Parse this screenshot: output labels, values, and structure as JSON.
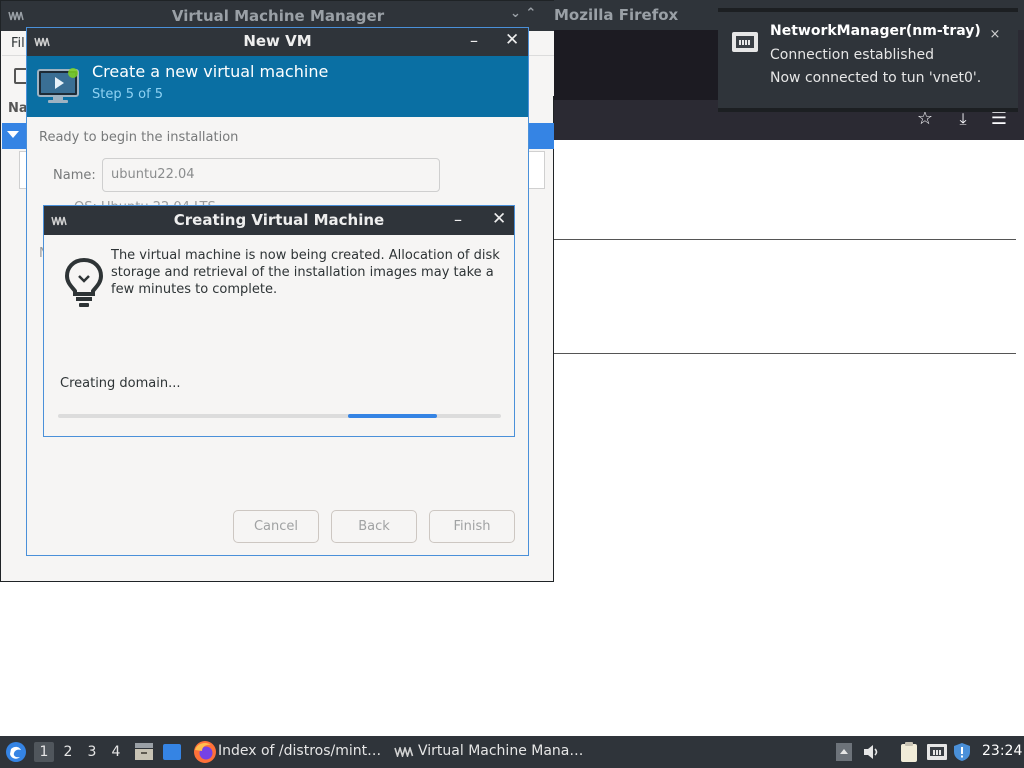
{
  "background": {
    "vmm": {
      "title": "Virtual Machine Manager",
      "menu_file": "Fil",
      "column_header": "Na"
    },
    "firefox": {
      "title": "Mozilla Firefox",
      "title_controls": "⌄ ⌃",
      "star_icon": "star-icon",
      "download_icon": "download-icon",
      "menu_icon": "hamburger-menu-icon"
    }
  },
  "new_vm": {
    "title": "New VM",
    "heading": "Create a new virtual machine",
    "step": "Step 5 of 5",
    "ready_text": "Ready to begin the installation",
    "name_label": "Name:",
    "name_value": "ubuntu22.04",
    "os_partial": "OS: Ubuntu 22.04 LTS",
    "side_partial": "N",
    "buttons": {
      "cancel": "Cancel",
      "back": "Back",
      "finish": "Finish"
    },
    "controls": {
      "minimize": "–",
      "close": "✕"
    }
  },
  "creating_dialog": {
    "title": "Creating Virtual Machine",
    "message": "The virtual machine is now being created. Allocation of disk storage and retrieval of the installation images may take a few minutes to complete.",
    "status": "Creating domain...",
    "progress": {
      "indeterminate": true,
      "segment_start": 0.655,
      "segment_end": 0.855
    },
    "controls": {
      "minimize": "–",
      "close": "✕"
    }
  },
  "notification": {
    "title": "NetworkManager(nm-tray)",
    "line1": "Connection established",
    "line2": "Now connected to tun 'vnet0'.",
    "close": "×"
  },
  "taskbar": {
    "workspaces": [
      "1",
      "2",
      "3",
      "4"
    ],
    "active_workspace": "1",
    "firefox_task": "Index of /distros/mint…",
    "vmm_task": "Virtual Machine Mana…",
    "clock": "23:24"
  },
  "colors": {
    "titlebar": "#2f343a",
    "header_blue": "#0a6fa3",
    "accent": "#3584e4",
    "dialog_bg": "#f6f5f4"
  }
}
